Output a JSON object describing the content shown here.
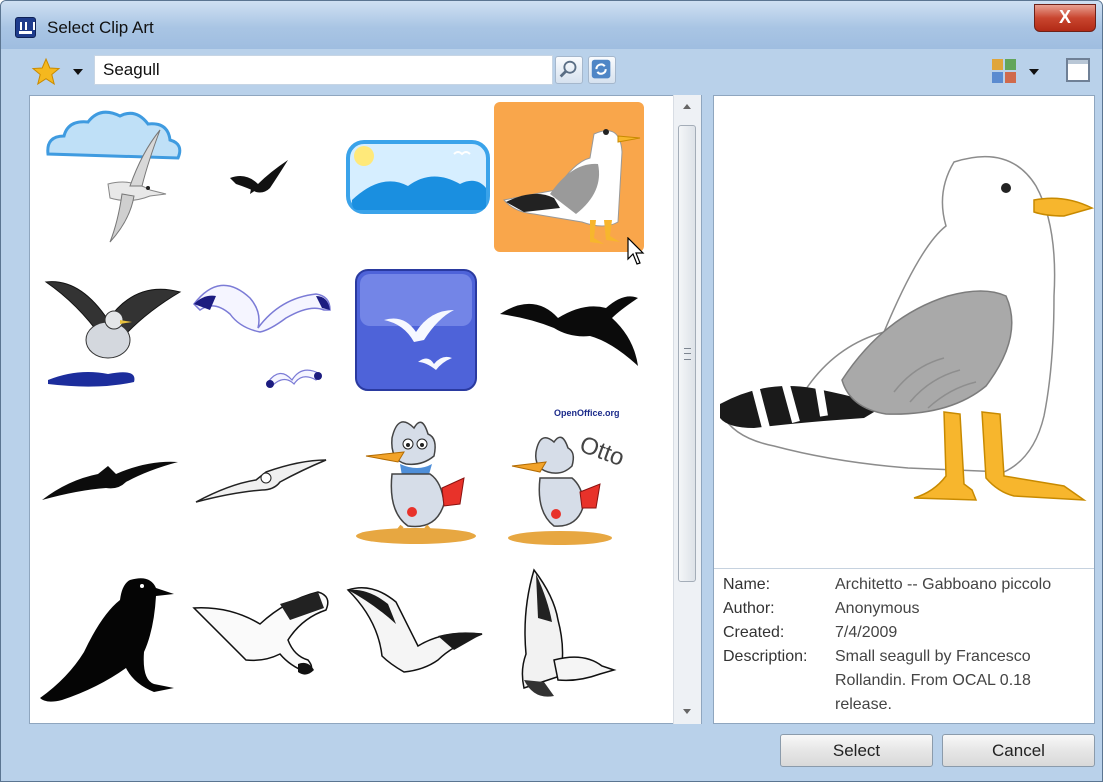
{
  "window": {
    "title": "Select Clip Art"
  },
  "toolbar": {
    "search_value": "Seagull",
    "icons": [
      "star-icon",
      "search-icon",
      "refresh-icon",
      "view-toggle-icon",
      "preview-pane-icon"
    ]
  },
  "gallery": {
    "items": [
      "seagull-with-cloud",
      "black-bird-silhouette-small",
      "blue-waves-tile",
      "gull-on-orange-tile",
      "gull-landing-on-water",
      "purple-seagull-outline",
      "blue-gull-button",
      "black-bird-flying",
      "gull-gliding-silhouette",
      "gull-gliding-outline",
      "cartoon-seagull",
      "cartoon-seagull-otto",
      "black-gull-silhouette",
      "gull-sketch-flying",
      "gull-sketch-diving",
      "gull-sketch-standing"
    ],
    "sticker_text": {
      "brand": "OpenOffice.org",
      "name": "Otto"
    }
  },
  "details": {
    "name_label": "Name:",
    "name_value": "Architetto -- Gabboano piccolo",
    "author_label": "Author:",
    "author_value": "Anonymous",
    "created_label": "Created:",
    "created_value": "7/4/2009",
    "description_label": "Description:",
    "description_lines": [
      "Small seagull by Francesco",
      "Rollandin. From OCAL 0.18",
      "release."
    ]
  },
  "buttons": {
    "select": "Select",
    "cancel": "Cancel",
    "close": "X"
  }
}
